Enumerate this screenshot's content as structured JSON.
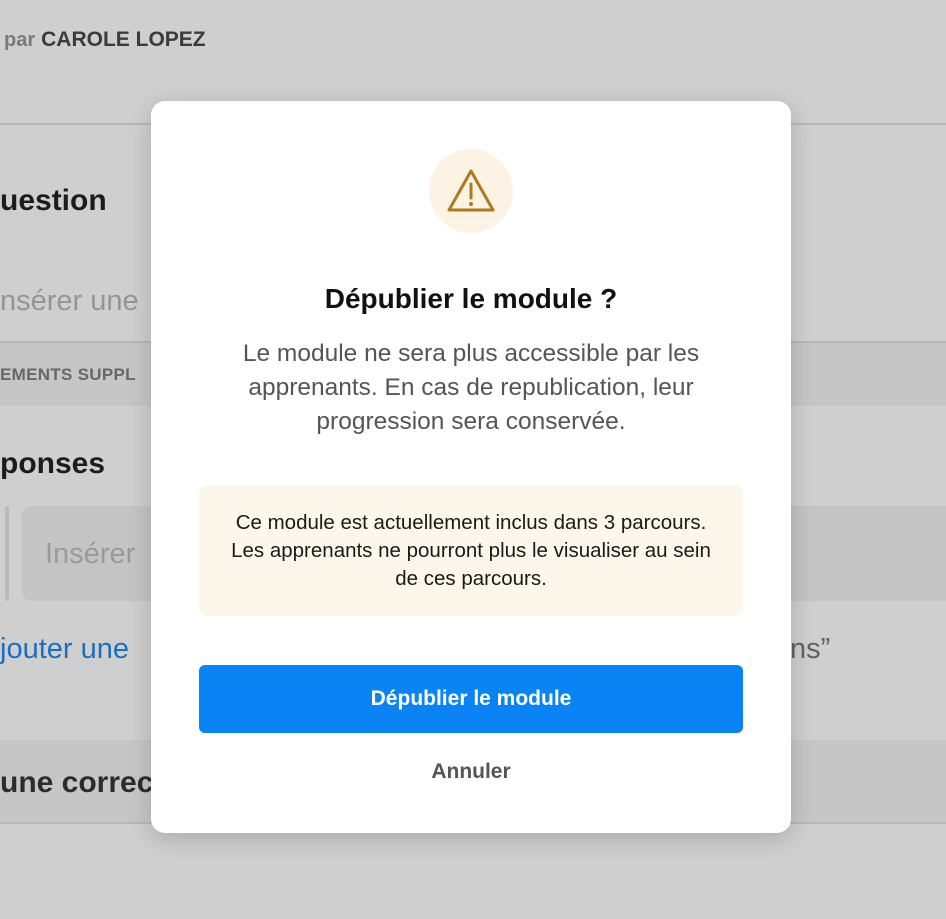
{
  "background": {
    "author_prefix": "par",
    "author_name": "CAROLE LOPEZ",
    "question_heading": "uestion",
    "question_placeholder": "nsérer une",
    "elements_bar_label": "EMENTS SUPPL",
    "responses_heading": "ponses",
    "response_placeholder": "Insérer",
    "add_link_label": "jouter une",
    "quote_tail": "ns”",
    "correction_label": "une correc"
  },
  "modal": {
    "icon": "warning-triangle-icon",
    "accent_color": "#b07a1a",
    "title": "Dépublier le module ?",
    "description": "Le module ne sera plus accessible par les apprenants. En cas de republication, leur progression sera conservée.",
    "notice": "Ce module est actuellement inclus dans 3 parcours. Les apprenants ne pourront plus le visualiser au sein de ces parcours.",
    "confirm_label": "Dépublier le module",
    "confirm_color": "#0a84f5",
    "cancel_label": "Annuler"
  }
}
